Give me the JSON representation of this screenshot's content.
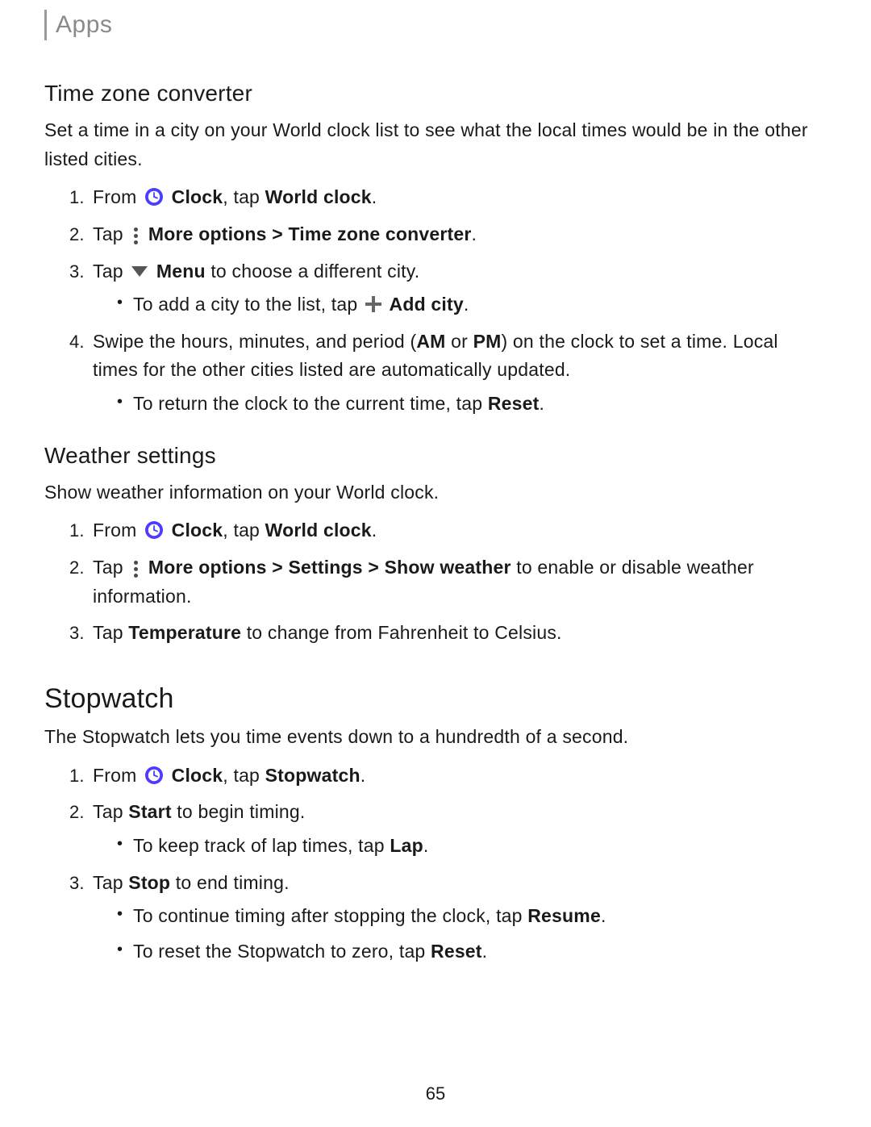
{
  "breadcrumb": "Apps",
  "page_number": "65",
  "tzc": {
    "heading": "Time zone converter",
    "intro": "Set a time in a city on your World clock list to see what the local times would be in the other listed cities.",
    "step1_pre": "From ",
    "step1_clock": "Clock",
    "step1_mid": ", tap ",
    "step1_world": "World clock",
    "step1_end": ".",
    "step2_pre": "Tap ",
    "step2_more": "More options",
    "step2_gt": " > ",
    "step2_tzc": "Time zone converter",
    "step2_end": ".",
    "step3_pre": "Tap ",
    "step3_menu": "Menu",
    "step3_post": " to choose a different city.",
    "step3a_pre": "To add a city to the list, tap ",
    "step3a_add": "Add city",
    "step3a_end": ".",
    "step4_pre": "Swipe the hours, minutes, and period (",
    "step4_am": "AM",
    "step4_or": " or ",
    "step4_pm": "PM",
    "step4_post": ") on the clock to set a time. Local times for the other cities listed are automatically updated.",
    "step4a_pre": "To return the clock to the current time, tap ",
    "step4a_reset": "Reset",
    "step4a_end": "."
  },
  "ws": {
    "heading": "Weather settings",
    "intro": "Show weather information on your World clock.",
    "step1_pre": "From ",
    "step1_clock": "Clock",
    "step1_mid": ", tap ",
    "step1_world": "World clock",
    "step1_end": ".",
    "step2_pre": "Tap ",
    "step2_more": "More options",
    "step2_gt1": " > ",
    "step2_settings": "Settings",
    "step2_gt2": " > ",
    "step2_show": "Show weather",
    "step2_post": " to enable or disable weather information.",
    "step3_pre": "Tap ",
    "step3_temp": "Temperature",
    "step3_post": " to change from Fahrenheit to Celsius."
  },
  "sw": {
    "heading": "Stopwatch",
    "intro": "The Stopwatch lets you time events down to a hundredth of a second.",
    "step1_pre": "From ",
    "step1_clock": "Clock",
    "step1_mid": ", tap ",
    "step1_sw": "Stopwatch",
    "step1_end": ".",
    "step2_pre": "Tap ",
    "step2_start": "Start",
    "step2_post": " to begin timing.",
    "step2a_pre": "To keep track of lap times, tap ",
    "step2a_lap": "Lap",
    "step2a_end": ".",
    "step3_pre": "Tap ",
    "step3_stop": "Stop",
    "step3_post": " to end timing.",
    "step3a_pre": "To continue timing after stopping the clock, tap ",
    "step3a_resume": "Resume",
    "step3a_end": ".",
    "step3b_pre": "To reset the Stopwatch to zero, tap ",
    "step3b_reset": "Reset",
    "step3b_end": "."
  }
}
